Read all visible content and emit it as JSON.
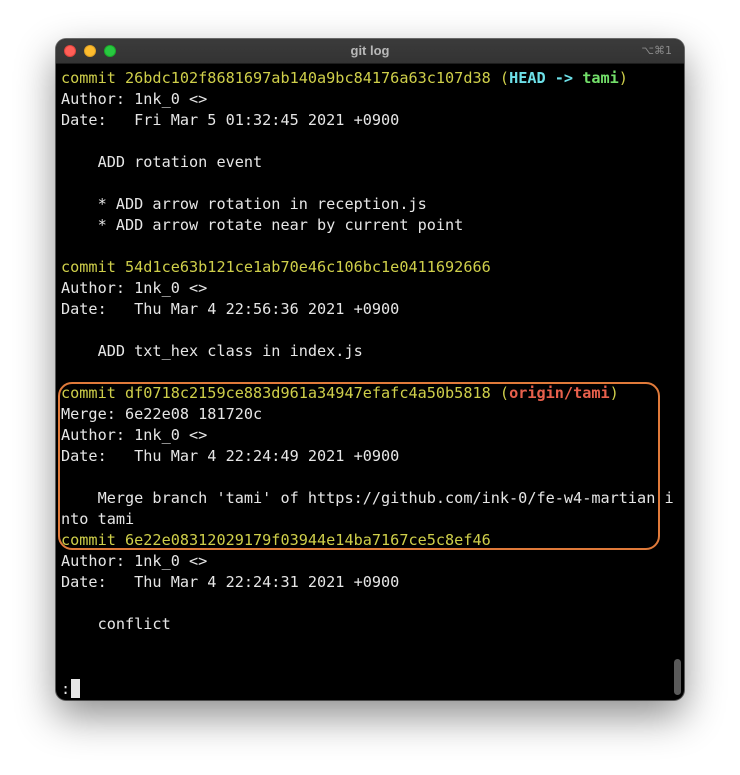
{
  "window": {
    "title": "git log",
    "shortcut": "⌥⌘1"
  },
  "colors": {
    "commit_hash": "#cfcf4a",
    "head": "#6de0e8",
    "local_branch": "#73e06a",
    "remote_branch": "#e8604c",
    "highlight_border": "#e07a3a"
  },
  "log": {
    "c1": {
      "commit": "commit 26bdc102f8681697ab140a9bc84176a63c107d38",
      "ref_open": " (",
      "head": "HEAD -> ",
      "branch": "tami",
      "ref_close": ")",
      "author": "Author: 1nk_0 <>",
      "date": "Date:   Fri Mar 5 01:32:45 2021 +0900",
      "msg1": "    ADD rotation event",
      "msg2": "    * ADD arrow rotation in reception.js",
      "msg3": "    * ADD arrow rotate near by current point"
    },
    "c2": {
      "commit": "commit 54d1ce63b121ce1ab70e46c106bc1e0411692666",
      "author": "Author: 1nk_0 <>",
      "date": "Date:   Thu Mar 4 22:56:36 2021 +0900",
      "msg1": "    ADD txt_hex class in index.js"
    },
    "c3": {
      "commit": "commit df0718c2159ce883d961a34947efafc4a50b5818",
      "ref_open": " (",
      "origin": "origin/tami",
      "ref_close": ")",
      "merge": "Merge: 6e22e08 181720c",
      "author": "Author: 1nk_0 <>",
      "date": "Date:   Thu Mar 4 22:24:49 2021 +0900",
      "msg1": "    Merge branch 'tami' of https://github.com/ink-0/fe-w4-martian i",
      "msg2": "nto tami"
    },
    "c4": {
      "commit": "commit 6e22e08312029179f03944e14ba7167ce5c8ef46",
      "author": "Author: 1nk_0 <>",
      "date": "Date:   Thu Mar 4 22:24:31 2021 +0900",
      "msg1": "    conflict"
    }
  },
  "pager": {
    "prompt": ":"
  }
}
